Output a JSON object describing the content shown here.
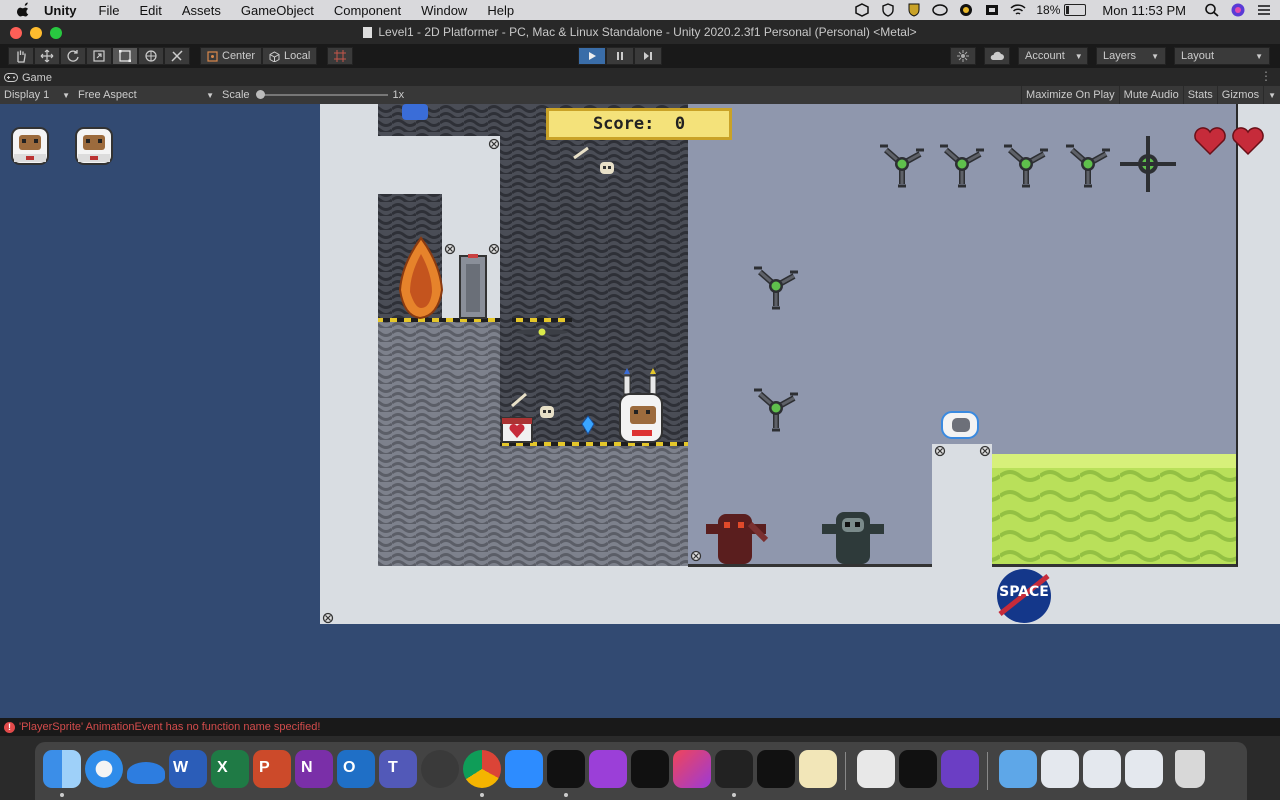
{
  "menubar": {
    "app": "Unity",
    "menus": [
      "File",
      "Edit",
      "Assets",
      "GameObject",
      "Component",
      "Window",
      "Help"
    ],
    "battery": "18%",
    "battery_level": 0.18,
    "clock": "Mon 11:53 PM"
  },
  "window": {
    "title": "Level1 - 2D Platformer - PC, Mac & Linux Standalone - Unity 2020.2.3f1 Personal (Personal) <Metal>"
  },
  "toolbar": {
    "center_label": "Center",
    "local_label": "Local",
    "account_label": "Account",
    "layers_label": "Layers",
    "layout_label": "Layout"
  },
  "game_tab": {
    "label": "Game",
    "display": "Display 1",
    "aspect": "Free Aspect",
    "scale_label": "Scale",
    "scale_value": "1x",
    "maximize_label": "Maximize On Play",
    "mute_label": "Mute Audio",
    "stats_label": "Stats",
    "gizmos_label": "Gizmos"
  },
  "game": {
    "score_text": "Score:  0",
    "logo_text": "SPACE",
    "lives_count": 2,
    "hearts_count": 2
  },
  "console": {
    "message": "'PlayerSprite' AnimationEvent has no function name specified!"
  },
  "colors": {
    "game_bg": "#324a72",
    "level_frame": "#d9dde2",
    "acid": "#b9e05a",
    "score_panel": "#f4e27a",
    "heart": "#c62b3a"
  },
  "dock": {
    "apps": [
      "finder-icon",
      "safari-icon",
      "onedrive-icon",
      "word-icon",
      "excel-icon",
      "powerpoint-icon",
      "onenote-icon",
      "outlook-icon",
      "teams-icon",
      "aseprite-icon",
      "chrome-icon",
      "zoom-icon",
      "unity-icon",
      "podcasts-icon",
      "appletv-icon",
      "creative-cloud-icon",
      "unity-hub-icon",
      "unity-icon",
      "script-editor-icon",
      "textedit-icon",
      "unity-icon",
      "visual-studio-icon",
      "downloads-folder-icon",
      "screenshot-icon",
      "screenshot-icon",
      "screenshot-icon",
      "trash-icon"
    ]
  }
}
